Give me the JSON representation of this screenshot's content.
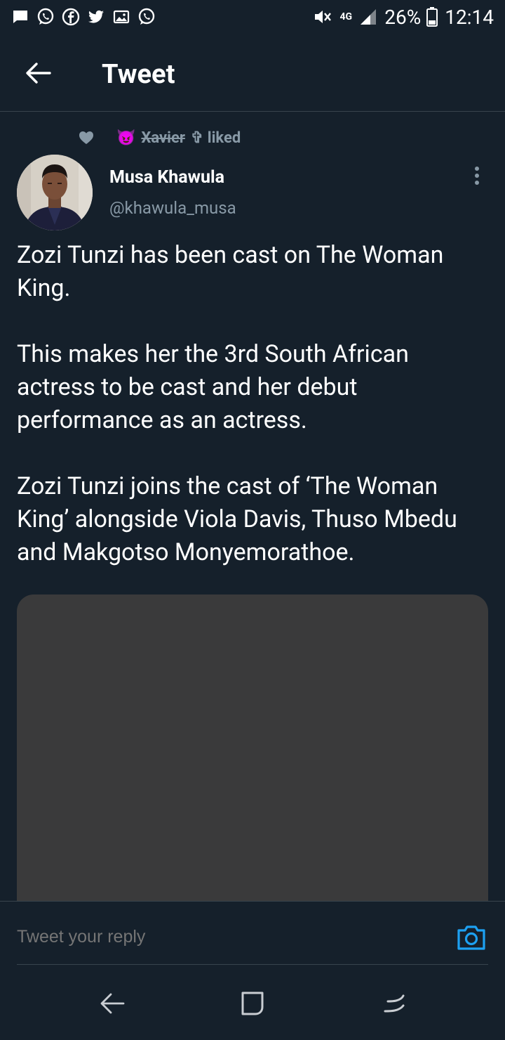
{
  "status_bar": {
    "left_icons": [
      "message-icon",
      "whatsapp-icon",
      "facebook-icon",
      "twitter-icon",
      "gallery-icon",
      "whatsapp-icon"
    ],
    "network": "4G",
    "battery": "26%",
    "time": "12:14"
  },
  "app_bar": {
    "title": "Tweet"
  },
  "social_context": {
    "emoji": "😈",
    "name": "Xavier",
    "suffix": "✞ liked"
  },
  "author": {
    "name": "Musa Khawula",
    "handle": "@khawula_musa"
  },
  "tweet": {
    "paragraphs": [
      "Zozi Tunzi has been cast on The Woman King.",
      "This makes her the 3rd South African actress to be cast and her debut performance as an actress.",
      "Zozi Tunzi joins the cast of ‘The Woman King’ alongside Viola Davis, Thuso Mbedu and Makgotso Monyemorathoe."
    ]
  },
  "reply": {
    "placeholder": "Tweet your reply"
  },
  "colors": {
    "background": "#15202b",
    "secondary_text": "#8899a6",
    "accent": "#1da1f2",
    "divider": "#38444d",
    "media_placeholder": "#3a3a3b"
  }
}
